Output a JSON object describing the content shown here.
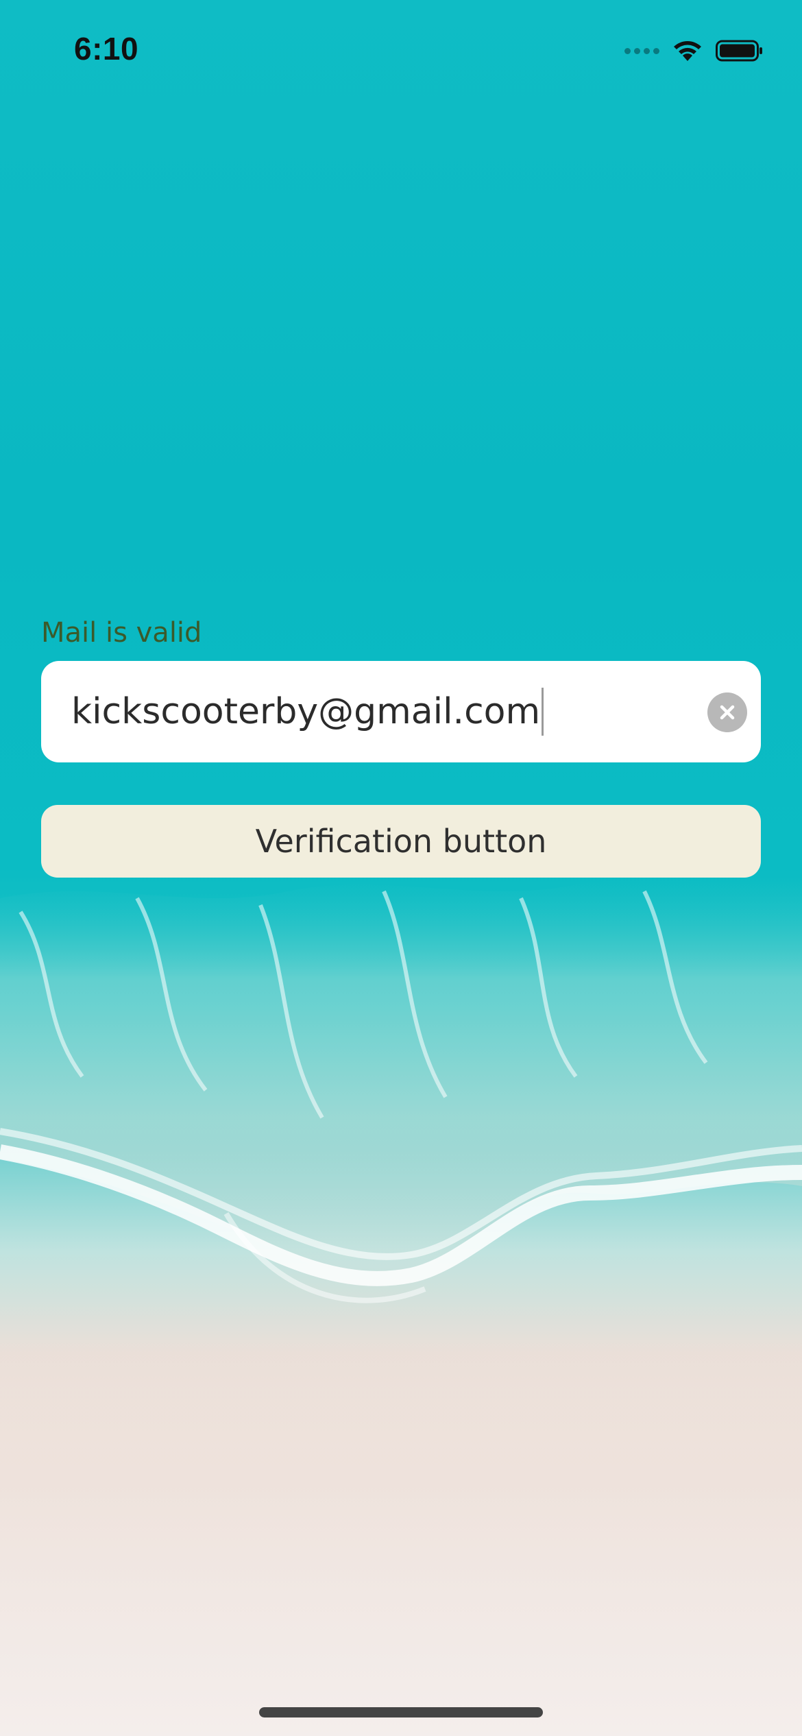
{
  "status_bar": {
    "time": "6:10",
    "icons": [
      "cellular-signal-icon",
      "wifi-icon",
      "battery-icon"
    ]
  },
  "form": {
    "validation_message": "Mail is valid",
    "email": {
      "value": "kickscooterby@gmail.com",
      "clear_icon": "clear-icon"
    },
    "verify_button_label": "Verification button"
  },
  "colors": {
    "sea": "#0bbcc4",
    "sand": "#f1e5de",
    "validation_text": "#3b5a2a",
    "button_bg": "#f2eedd",
    "field_bg": "#ffffff"
  }
}
